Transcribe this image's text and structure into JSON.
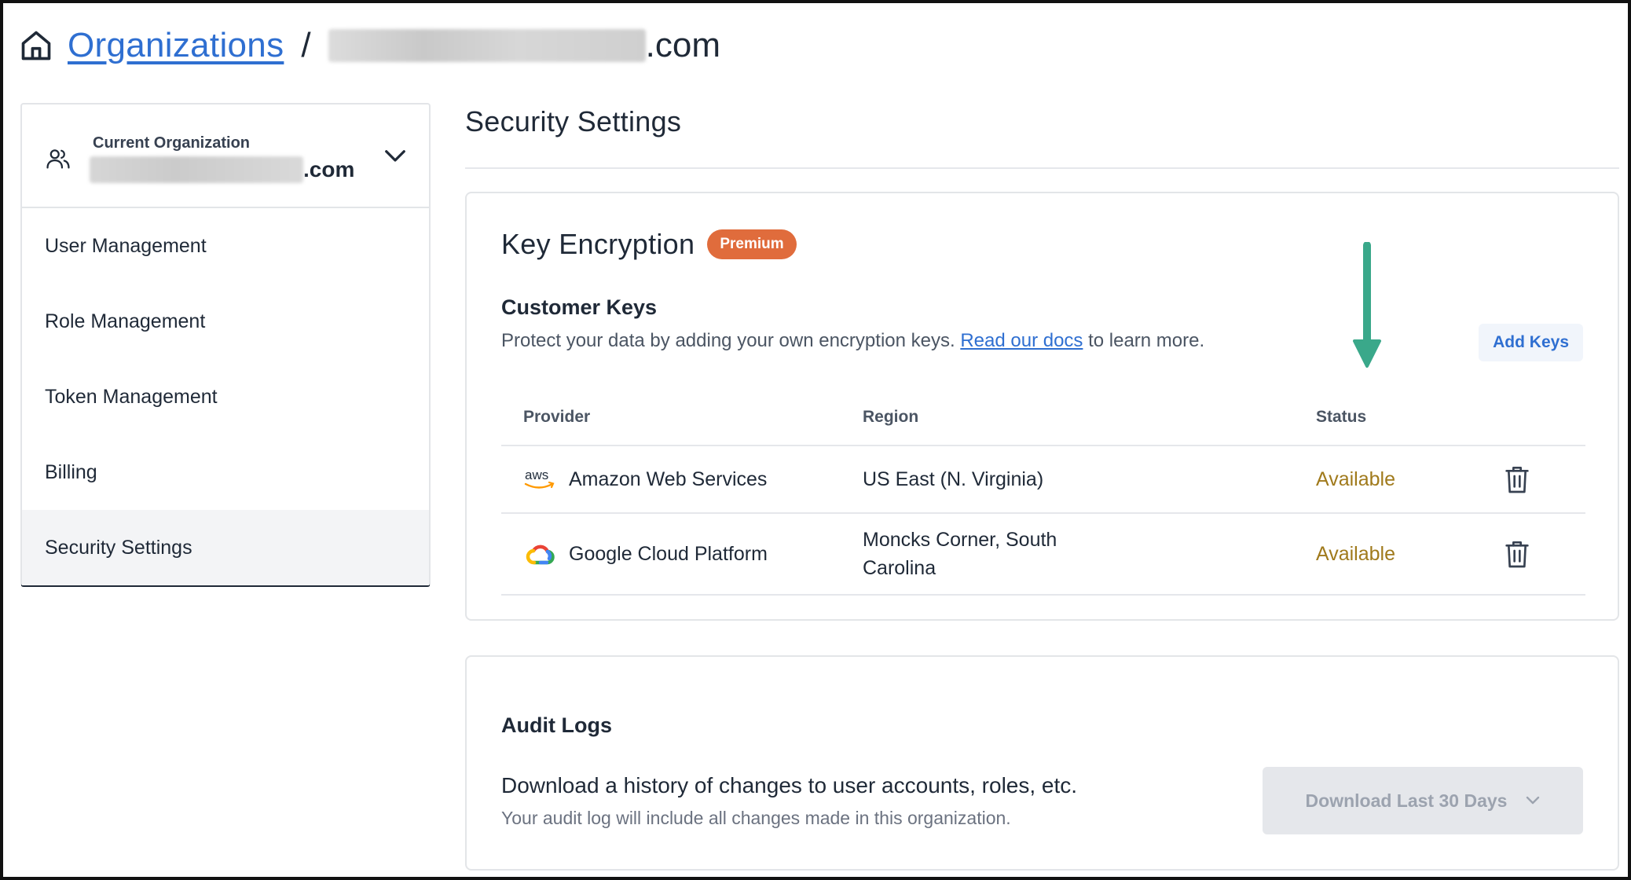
{
  "breadcrumb": {
    "root_label": "Organizations",
    "separator": "/",
    "current_suffix": ".com"
  },
  "sidebar": {
    "org_switcher": {
      "caption": "Current Organization",
      "org_suffix": ".com"
    },
    "items": [
      {
        "label": "User Management",
        "active": false
      },
      {
        "label": "Role Management",
        "active": false
      },
      {
        "label": "Token Management",
        "active": false
      },
      {
        "label": "Billing",
        "active": false
      },
      {
        "label": "Security Settings",
        "active": true
      }
    ]
  },
  "main": {
    "title": "Security Settings",
    "key_encryption": {
      "heading": "Key Encryption",
      "badge": "Premium",
      "customer_keys": {
        "title": "Customer Keys",
        "description_before": "Protect your data by adding your own encryption keys. ",
        "docs_link": "Read our docs",
        "description_after": " to learn more.",
        "add_button": "Add Keys"
      },
      "table": {
        "columns": [
          "Provider",
          "Region",
          "Status"
        ],
        "rows": [
          {
            "provider": "Amazon Web Services",
            "provider_icon": "aws-logo-icon",
            "region": "US East (N. Virginia)",
            "status": "Available"
          },
          {
            "provider": "Google Cloud Platform",
            "provider_icon": "google-cloud-logo-icon",
            "region": "Moncks Corner, South Carolina",
            "status": "Available"
          }
        ]
      }
    },
    "audit_logs": {
      "title": "Audit Logs",
      "description": "Download a history of changes to user accounts, roles, etc.",
      "subtext": "Your audit log will include all changes made in this organization.",
      "download_button": "Download Last 30 Days"
    }
  },
  "colors": {
    "link": "#2f6fd1",
    "premium_badge": "#e06c3c",
    "status_available": "#a07a1c",
    "annotation_arrow": "#3aa88a",
    "active_sidebar_underline": "#1f2937"
  }
}
